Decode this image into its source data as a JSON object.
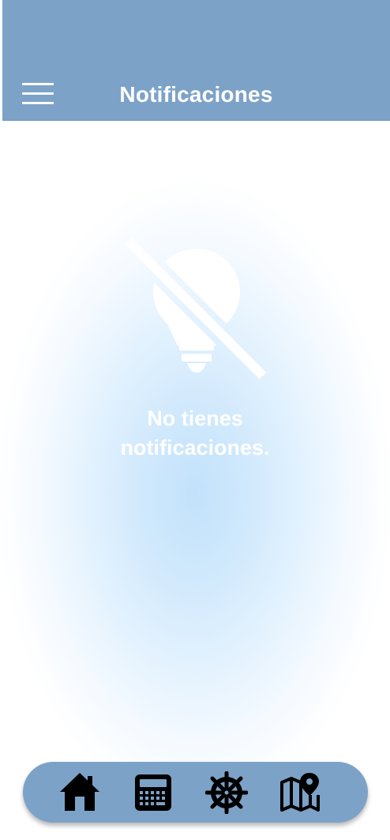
{
  "header": {
    "title": "Notificaciones",
    "menu_icon": "hamburger-menu-icon",
    "background_color": "#7da2c8"
  },
  "empty_state": {
    "icon": "lightbulb-off-icon",
    "line1": "No tienes",
    "line2": "notificaciones."
  },
  "bottom_nav": {
    "background_color": "#7da2c8",
    "items": [
      {
        "icon": "home-icon"
      },
      {
        "icon": "calculator-icon"
      },
      {
        "icon": "ship-wheel-icon"
      },
      {
        "icon": "map-pin-icon"
      }
    ]
  }
}
